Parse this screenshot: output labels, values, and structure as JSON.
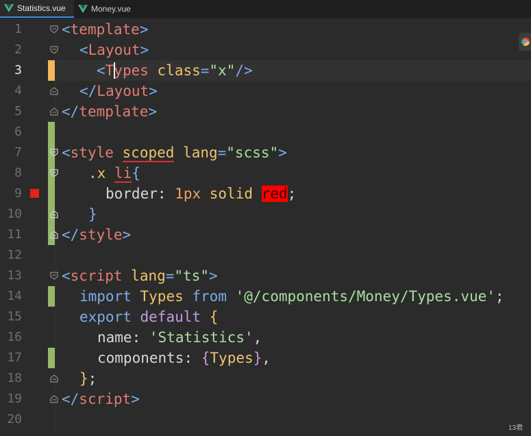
{
  "tabs": [
    {
      "label": "Statistics.vue",
      "active": true,
      "icon": "vue-icon"
    },
    {
      "label": "Money.vue",
      "active": false,
      "icon": "vue-icon"
    }
  ],
  "editor": {
    "current_line": 3,
    "lines": [
      {
        "n": "1"
      },
      {
        "n": "2"
      },
      {
        "n": "3"
      },
      {
        "n": "4"
      },
      {
        "n": "5"
      },
      {
        "n": "6"
      },
      {
        "n": "7"
      },
      {
        "n": "8"
      },
      {
        "n": "9"
      },
      {
        "n": "10"
      },
      {
        "n": "11"
      },
      {
        "n": "12"
      },
      {
        "n": "13"
      },
      {
        "n": "14"
      },
      {
        "n": "15"
      },
      {
        "n": "16"
      },
      {
        "n": "17"
      },
      {
        "n": "18"
      },
      {
        "n": "19"
      },
      {
        "n": "20"
      }
    ],
    "code": {
      "l1": {
        "open": "<",
        "tag": "template",
        "close": ">"
      },
      "l2": {
        "open": "<",
        "tag": "Layout",
        "close": ">"
      },
      "l3": {
        "open": "<",
        "tag": "Types",
        "attr": "class",
        "eq": "=",
        "val": "\"x\"",
        "close": "/>"
      },
      "l4": {
        "open": "</",
        "tag": "Layout",
        "close": ">"
      },
      "l5": {
        "open": "</",
        "tag": "template",
        "close": ">"
      },
      "l7": {
        "open": "<",
        "tag": "style",
        "attr1": "scoped",
        "attr2": "lang",
        "eq": "=",
        "val": "\"scss\"",
        "close": ">"
      },
      "l8": {
        "sel": ".x",
        "sel2": "li",
        "brace": "{"
      },
      "l9": {
        "prop": "border",
        "colon": ":",
        "num": "1px",
        "v1": "solid",
        "v2": "red",
        "semi": ";"
      },
      "l10": {
        "brace": "}"
      },
      "l11": {
        "open": "</",
        "tag": "style",
        "close": ">"
      },
      "l13": {
        "open": "<",
        "tag": "script",
        "attr": "lang",
        "eq": "=",
        "val": "\"ts\"",
        "close": ">"
      },
      "l14": {
        "kw": "import",
        "name": "Types",
        "from": "from",
        "path": "'@/components/Money/Types.vue'",
        "semi": ";"
      },
      "l15": {
        "kw": "export",
        "kw2": "default",
        "brace": "{"
      },
      "l16": {
        "key": "name",
        "colon": ":",
        "val": "'Statistics'",
        "comma": ","
      },
      "l17": {
        "key": "components",
        "colon": ":",
        "ob": "{",
        "name": "Types",
        "cb": "}",
        "comma": ","
      },
      "l18": {
        "cb": "}",
        "semi": ";"
      },
      "l19": {
        "open": "</",
        "tag": "script",
        "close": ">"
      }
    }
  },
  "status": {
    "text": "13君"
  },
  "colors": {
    "accent": "#3b8eea",
    "breakpoint": "#e2231a",
    "modified": "#97b86a",
    "current_change": "#f2b65c"
  }
}
